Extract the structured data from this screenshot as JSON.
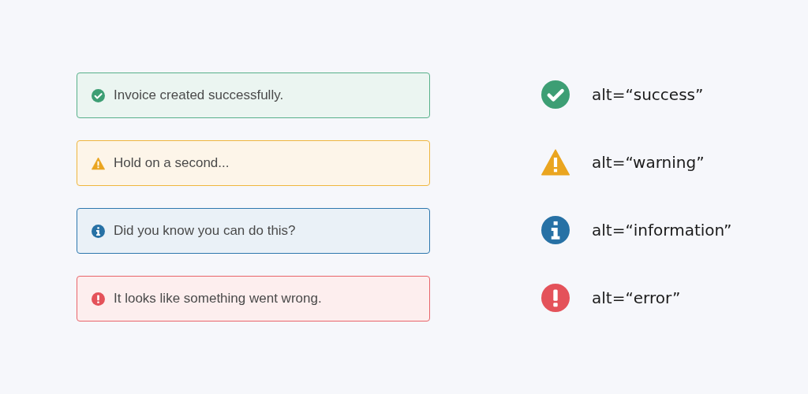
{
  "alerts": [
    {
      "kind": "success",
      "message": "Invoice created successfully."
    },
    {
      "kind": "warning",
      "message": "Hold on a second..."
    },
    {
      "kind": "info",
      "message": "Did you know you can do this?"
    },
    {
      "kind": "error",
      "message": "It looks like something went wrong."
    }
  ],
  "legend": [
    {
      "kind": "success",
      "label": "alt=“success”"
    },
    {
      "kind": "warning",
      "label": "alt=“warning”"
    },
    {
      "kind": "info",
      "label": "alt=“information”"
    },
    {
      "kind": "error",
      "label": "alt=“error”"
    }
  ]
}
